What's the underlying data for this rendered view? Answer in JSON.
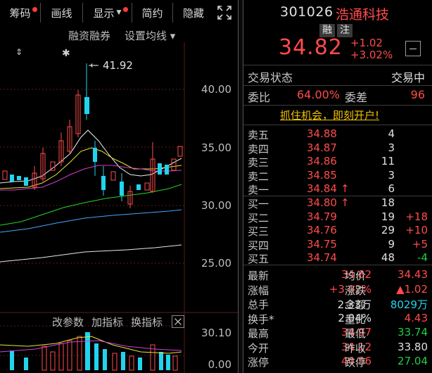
{
  "toolbar": {
    "items": [
      {
        "label": "筹码",
        "dot": true
      },
      {
        "label": "画线",
        "dot": false
      },
      {
        "label": "显示",
        "dot": true,
        "caret": true
      },
      {
        "label": "简约",
        "dot": false
      },
      {
        "label": "隐藏",
        "dot": false
      }
    ]
  },
  "chart_links": {
    "margin": "融资融券",
    "ma_settings": "设置均线"
  },
  "price_axis": [
    "40.00",
    "35.00",
    "30.00",
    "25.00"
  ],
  "high_marker": "41.92",
  "indicator_bar": {
    "params": "改参数",
    "add": "加指标",
    "switch": "换指标"
  },
  "volume_axis": [
    "30.10",
    "0.00"
  ],
  "quote": {
    "code": "301026",
    "name": "浩通科技",
    "tags": [
      "融",
      "注"
    ],
    "price": "34.82",
    "change": "+1.02",
    "change_pct": "+3.02%",
    "status_label": "交易状态",
    "status_value": "交易中",
    "wb_label": "委比",
    "wb_value": "64.00%",
    "wc_label": "委差",
    "wc_value": "96",
    "promo": "抓住机会，即刻开户!"
  },
  "order_book": {
    "asks": [
      {
        "label": "卖五",
        "price": "34.88",
        "vol": "4",
        "arrow": "",
        "delta": ""
      },
      {
        "label": "卖四",
        "price": "34.87",
        "vol": "3",
        "arrow": "",
        "delta": ""
      },
      {
        "label": "卖三",
        "price": "34.86",
        "vol": "11",
        "arrow": "",
        "delta": ""
      },
      {
        "label": "卖二",
        "price": "34.85",
        "vol": "3",
        "arrow": "",
        "delta": ""
      },
      {
        "label": "卖一",
        "price": "34.84",
        "vol": "6",
        "arrow": "↑",
        "delta": ""
      }
    ],
    "bids": [
      {
        "label": "买一",
        "price": "34.80",
        "vol": "18",
        "arrow": "↑",
        "delta": ""
      },
      {
        "label": "买二",
        "price": "34.79",
        "vol": "19",
        "arrow": "",
        "delta": "+18"
      },
      {
        "label": "买三",
        "price": "34.76",
        "vol": "29",
        "arrow": "",
        "delta": "+10"
      },
      {
        "label": "买四",
        "price": "34.75",
        "vol": "9",
        "arrow": "",
        "delta": "+5"
      },
      {
        "label": "买五",
        "price": "34.74",
        "vol": "48",
        "arrow": "",
        "delta": "-4"
      }
    ]
  },
  "stats": [
    {
      "l1": "最新",
      "v1": "34.82",
      "c1": "#ff4b4b",
      "l2": "均价",
      "v2": "34.43",
      "c2": "#ff4b4b"
    },
    {
      "l1": "涨幅",
      "v1": "+3.02%",
      "c1": "#ff4b4b",
      "l2": "涨跌",
      "v2": "▲1.02",
      "c2": "#ff4b4b"
    },
    {
      "l1": "总手",
      "v1": "2.33万",
      "c1": "#e0e0e0",
      "l2": "金额",
      "v2": "8029万",
      "c2": "#22d3ee"
    },
    {
      "l1": "换手*",
      "v1": "2.04%",
      "c1": "#e0e0e0",
      "l2": "量比",
      "v2": "4.43",
      "c2": "#ff4b4b"
    },
    {
      "l1": "最高",
      "v1": "34.97",
      "c1": "#ff4b4b",
      "l2": "最低",
      "v2": "33.74",
      "c2": "#22cc44"
    },
    {
      "l1": "今开",
      "v1": "34.12",
      "c1": "#ff4b4b",
      "l2": "昨收",
      "v2": "33.80",
      "c2": "#e0e0e0"
    },
    {
      "l1": "涨停",
      "v1": "40.56",
      "c1": "#ff4b4b",
      "l2": "跌停",
      "v2": "27.04",
      "c2": "#22cc44"
    }
  ],
  "colors": {
    "up": "#ff4b4b",
    "down": "#22d3ee",
    "promo": "#f2c200",
    "background": "#000000"
  }
}
